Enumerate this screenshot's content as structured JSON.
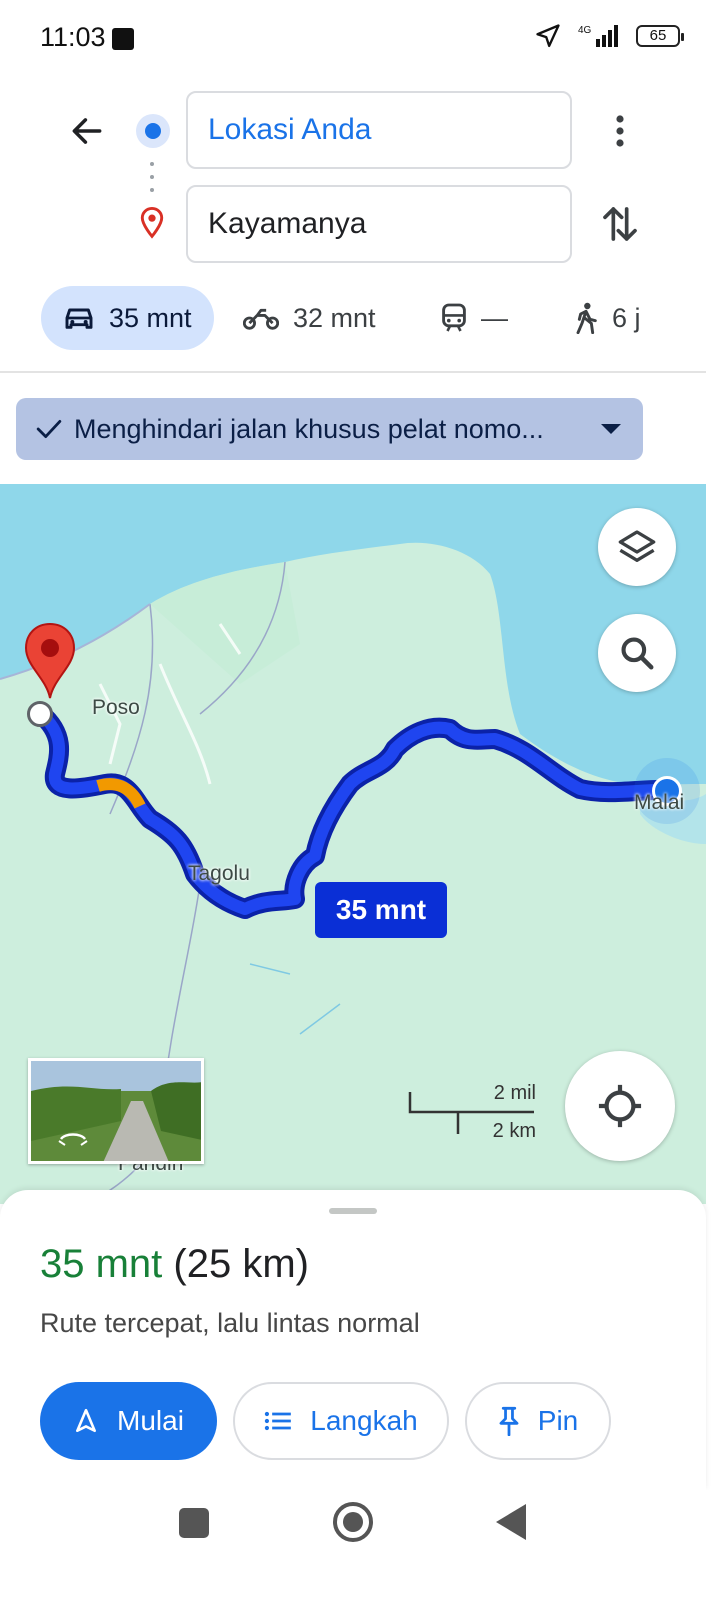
{
  "status_bar": {
    "time": "11:03",
    "network": "4G",
    "battery": "65"
  },
  "search": {
    "origin": "Lokasi Anda",
    "destination": "Kayamanya"
  },
  "modes": [
    {
      "icon": "car-icon",
      "label": "35 mnt",
      "active": true
    },
    {
      "icon": "motorcycle-icon",
      "label": "32 mnt",
      "active": false
    },
    {
      "icon": "transit-icon",
      "label": "—",
      "active": false
    },
    {
      "icon": "walk-icon",
      "label": "6 j",
      "active": false
    }
  ],
  "filter_chip": {
    "label": "Menghindari jalan khusus pelat nomo..."
  },
  "map": {
    "labels": {
      "poso": "Poso",
      "tagolu": "Tagolu",
      "malai": "Malai",
      "pandiri": "Pandiri"
    },
    "eta_bubble": "35 mnt",
    "scale": {
      "imperial": "2 mil",
      "metric": "2 km"
    },
    "route_color": "#1a3ee8",
    "traffic_color": "#f29900"
  },
  "sheet": {
    "eta": "35 mnt",
    "distance": "(25 km)",
    "description": "Rute tercepat, lalu lintas normal",
    "start_label": "Mulai",
    "steps_label": "Langkah",
    "pin_label": "Pin"
  },
  "colors": {
    "accent": "#1a73e8",
    "eta_green": "#188038",
    "chip_bg": "#b4c3e3"
  }
}
